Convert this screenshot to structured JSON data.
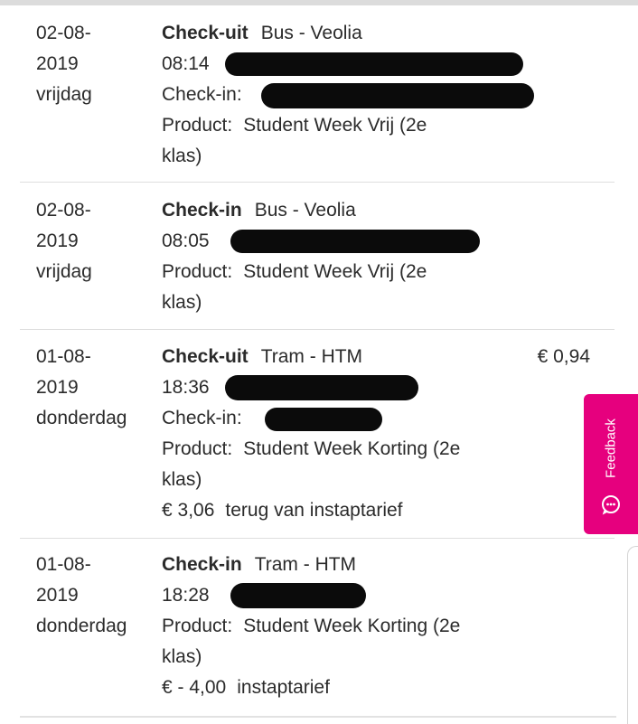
{
  "transactions": [
    {
      "date_line1": "02-08-",
      "date_line2": "2019",
      "weekday": "vrijdag",
      "type": "Check-uit",
      "mode": "Bus - Veolia",
      "time": "08:14",
      "checkin_label": "Check-in:",
      "product_label": "Product:",
      "product_name": "Student Week Vrij (2e",
      "product_class": "klas)",
      "amount": "",
      "fare_value": "",
      "fare_note": ""
    },
    {
      "date_line1": "02-08-",
      "date_line2": "2019",
      "weekday": "vrijdag",
      "type": "Check-in",
      "mode": "Bus - Veolia",
      "time": "08:05",
      "product_label": "Product:",
      "product_name": "Student Week Vrij (2e",
      "product_class": "klas)",
      "amount": "",
      "fare_value": "",
      "fare_note": ""
    },
    {
      "date_line1": "01-08-",
      "date_line2": "2019",
      "weekday": "donderdag",
      "type": "Check-uit",
      "mode": "Tram - HTM",
      "time": "18:36",
      "checkin_label": "Check-in:",
      "product_label": "Product:",
      "product_name": "Student Week Korting (2e",
      "product_class": "klas)",
      "amount": "€ 0,94",
      "fare_value": "€ 3,06",
      "fare_note": "terug van instaptarief"
    },
    {
      "date_line1": "01-08-",
      "date_line2": "2019",
      "weekday": "donderdag",
      "type": "Check-in",
      "mode": "Tram - HTM",
      "time": "18:28",
      "product_label": "Product:",
      "product_name": "Student Week Korting (2e",
      "product_class": "klas)",
      "amount": "",
      "fare_value": "€ - 4,00",
      "fare_note": "instaptarief"
    }
  ],
  "feedback": {
    "label": "Feedback",
    "icon": "chat-bubble-icon",
    "color": "#e6007e"
  }
}
